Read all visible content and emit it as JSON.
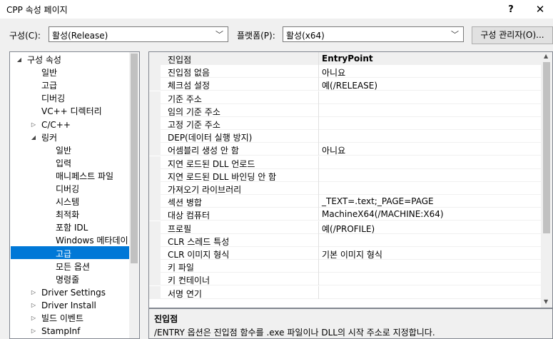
{
  "window": {
    "title": "CPP 속성 페이지",
    "help_label": "?",
    "close_label": "✕"
  },
  "toolbar": {
    "config_label": "구성(C):",
    "config_value": "활성(Release)",
    "platform_label": "플랫폼(P):",
    "platform_value": "활성(x64)",
    "manager_button": "구성 관리자(O)..."
  },
  "tree": {
    "items": [
      {
        "label": "구성 속성",
        "expander": "◢"
      },
      {
        "label": "일반",
        "expander": ""
      },
      {
        "label": "고급",
        "expander": ""
      },
      {
        "label": "디버깅",
        "expander": ""
      },
      {
        "label": "VC++ 디렉터리",
        "expander": ""
      },
      {
        "label": "C/C++",
        "expander": "▷"
      },
      {
        "label": "링커",
        "expander": "◢"
      },
      {
        "label": "일반",
        "expander": ""
      },
      {
        "label": "입력",
        "expander": ""
      },
      {
        "label": "매니페스트 파일",
        "expander": ""
      },
      {
        "label": "디버깅",
        "expander": ""
      },
      {
        "label": "시스템",
        "expander": ""
      },
      {
        "label": "최적화",
        "expander": ""
      },
      {
        "label": "포함 IDL",
        "expander": ""
      },
      {
        "label": "Windows 메타데이",
        "expander": ""
      },
      {
        "label": "고급",
        "expander": ""
      },
      {
        "label": "모든 옵션",
        "expander": ""
      },
      {
        "label": "명령줄",
        "expander": ""
      },
      {
        "label": "Driver Settings",
        "expander": "▷"
      },
      {
        "label": "Driver Install",
        "expander": "▷"
      },
      {
        "label": "빌드 이벤트",
        "expander": "▷"
      },
      {
        "label": "StampInf",
        "expander": "▷"
      }
    ]
  },
  "properties": [
    {
      "name": "진입점",
      "value": "EntryPoint"
    },
    {
      "name": "진입점 없음",
      "value": "아니요"
    },
    {
      "name": "체크섬 설정",
      "value": "예(/RELEASE)"
    },
    {
      "name": "기준 주소",
      "value": ""
    },
    {
      "name": "임의 기준 주소",
      "value": ""
    },
    {
      "name": "고정 기준 주소",
      "value": ""
    },
    {
      "name": "DEP(데이터 실행 방지)",
      "value": ""
    },
    {
      "name": "어셈블리 생성 안 함",
      "value": "아니요"
    },
    {
      "name": "지연 로드된 DLL 언로드",
      "value": ""
    },
    {
      "name": "지연 로드된 DLL 바인딩 안 함",
      "value": ""
    },
    {
      "name": "가져오기 라이브러리",
      "value": ""
    },
    {
      "name": "섹션 병합",
      "value": "_TEXT=.text;_PAGE=PAGE"
    },
    {
      "name": "대상 컴퓨터",
      "value": "MachineX64(/MACHINE:X64)"
    },
    {
      "name": "프로필",
      "value": "예(/PROFILE)"
    },
    {
      "name": "CLR 스레드 특성",
      "value": ""
    },
    {
      "name": "CLR 이미지 형식",
      "value": "기본 이미지 형식"
    },
    {
      "name": "키 파일",
      "value": ""
    },
    {
      "name": "키 컨테이너",
      "value": ""
    },
    {
      "name": "서명 연기",
      "value": ""
    }
  ],
  "description": {
    "title": "진입점",
    "text": "/ENTRY 옵션은 진입점 함수를 .exe 파일이나 DLL의 시작 주소로 지정합니다."
  },
  "colors": {
    "selection": "#0078d7"
  }
}
